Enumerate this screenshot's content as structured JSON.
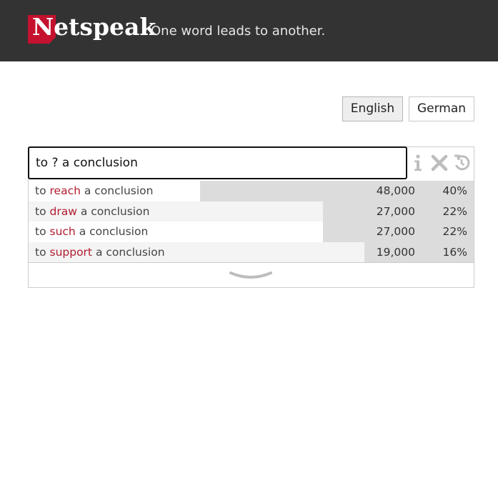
{
  "header": {
    "logo_text": "Netspeak",
    "tagline": "One word leads to another."
  },
  "languages": {
    "english_label": "English",
    "german_label": "German",
    "selected": "English"
  },
  "search": {
    "value": "to ? a conclusion"
  },
  "icons": {
    "info": "info-icon",
    "clear": "close-icon",
    "history": "history-icon",
    "more": "chevron-down-icon"
  },
  "colors": {
    "header_bg": "#333333",
    "logo_red": "#c4122f",
    "highlight_word": "#b01c2e",
    "bar": "#dcdcdc"
  },
  "results": [
    {
      "prefix": "to",
      "word": "reach",
      "suffix": "a conclusion",
      "count": "48,000",
      "percent": "40%",
      "share": 0.4
    },
    {
      "prefix": "to",
      "word": "draw",
      "suffix": "a conclusion",
      "count": "27,000",
      "percent": "22%",
      "share": 0.22
    },
    {
      "prefix": "to",
      "word": "such",
      "suffix": "a conclusion",
      "count": "27,000",
      "percent": "22%",
      "share": 0.22
    },
    {
      "prefix": "to",
      "word": "support",
      "suffix": "a conclusion",
      "count": "19,000",
      "percent": "16%",
      "share": 0.16
    }
  ]
}
